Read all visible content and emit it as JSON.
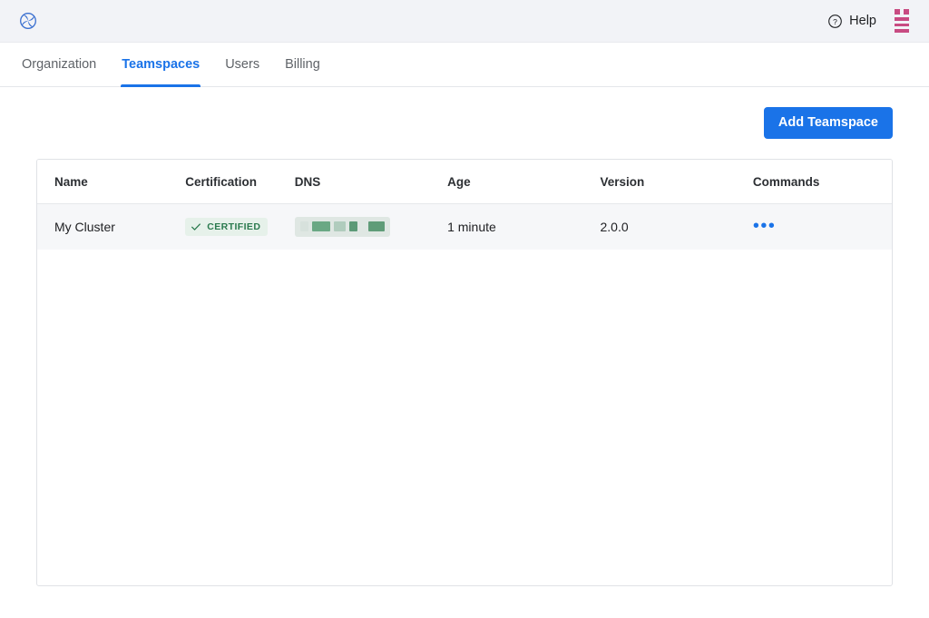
{
  "topbar": {
    "logo_icon": "swirl-logo-icon",
    "help_label": "Help",
    "help_icon": "question-circle-icon",
    "app_menu_icon": "app-grid-menu-icon",
    "accent_color": "#1a73e8",
    "menu_color": "#c84b82",
    "background": "#f2f3f7"
  },
  "tabs": [
    {
      "label": "Organization",
      "active": false
    },
    {
      "label": "Teamspaces",
      "active": true
    },
    {
      "label": "Users",
      "active": false
    },
    {
      "label": "Billing",
      "active": false
    }
  ],
  "actions": {
    "add_teamspace_label": "Add Teamspace"
  },
  "table": {
    "columns": [
      "Name",
      "Certification",
      "DNS",
      "Age",
      "Version",
      "Commands"
    ],
    "rows": [
      {
        "name": "My Cluster",
        "certification": "CERTIFIED",
        "certification_icon": "check-icon",
        "dns": "",
        "dns_redacted": true,
        "age": "1 minute",
        "version": "2.0.0",
        "commands_icon": "ellipsis-icon",
        "commands_label": "•••"
      }
    ]
  }
}
